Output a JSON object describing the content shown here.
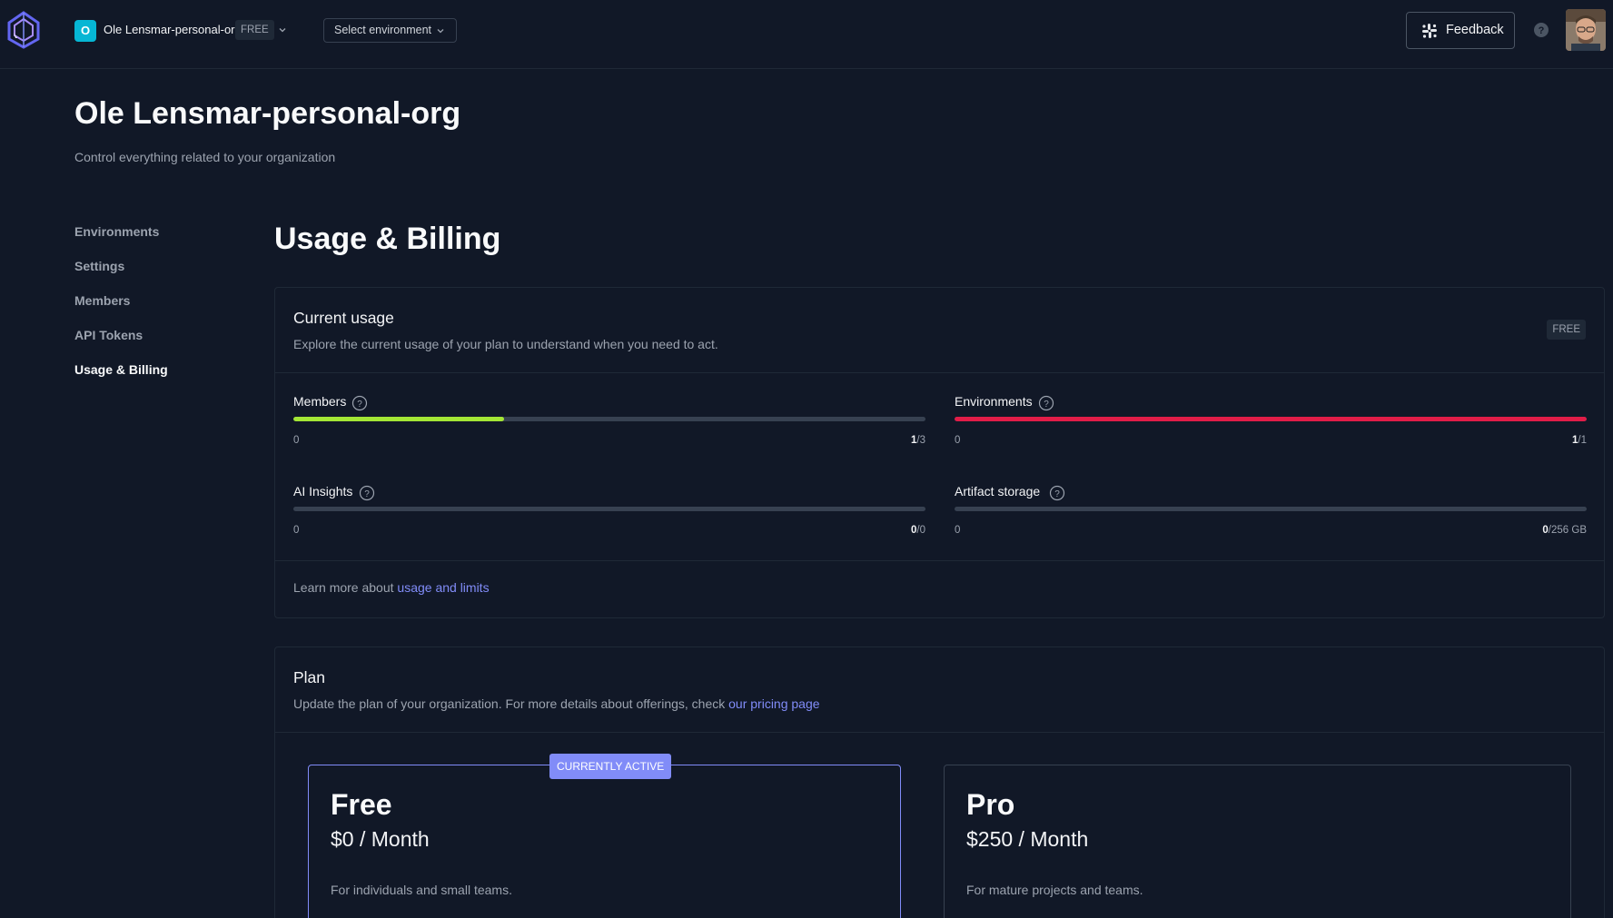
{
  "topbar": {
    "org_initial": "O",
    "org_name": "Ole Lensmar-personal-org",
    "org_plan": "FREE",
    "env_select_label": "Select environment",
    "feedback_label": "Feedback"
  },
  "header": {
    "title": "Ole Lensmar-personal-org",
    "subtitle": "Control everything related to your organization"
  },
  "sidebar": {
    "items": [
      {
        "label": "Environments"
      },
      {
        "label": "Settings"
      },
      {
        "label": "Members"
      },
      {
        "label": "API Tokens"
      },
      {
        "label": "Usage & Billing",
        "active": true
      }
    ]
  },
  "main": {
    "title": "Usage & Billing",
    "usage": {
      "title": "Current usage",
      "description": "Explore the current usage of your plan to understand when you need to act.",
      "plan_tag": "FREE",
      "meters": [
        {
          "label": "Members",
          "min": "0",
          "used": "1",
          "limit": "/3",
          "fraction": 0.3333,
          "color": "#a3e635"
        },
        {
          "label": "Environments",
          "min": "0",
          "used": "1",
          "limit": "/1",
          "fraction": 1.0,
          "color": "#e11d48"
        },
        {
          "label": "AI Insights",
          "min": "0",
          "used": "0",
          "limit": "/0",
          "fraction": 0,
          "color": "#a3e635"
        },
        {
          "label": "Artifact storage",
          "min": "0",
          "used": "0",
          "limit": "/256 GB",
          "fraction": 0,
          "color": "#a3e635"
        }
      ],
      "learn_prefix": "Learn more about ",
      "learn_link": "usage and limits"
    },
    "plan": {
      "title": "Plan",
      "description_prefix": "Update the plan of your organization. For more details about offerings, check ",
      "description_link": "our pricing page",
      "tiers": [
        {
          "name": "Free",
          "price": "$0 / Month",
          "description": "For individuals and small teams.",
          "badge": "CURRENTLY ACTIVE"
        },
        {
          "name": "Pro",
          "price": "$250 / Month",
          "description": "For mature projects and teams."
        }
      ]
    }
  }
}
